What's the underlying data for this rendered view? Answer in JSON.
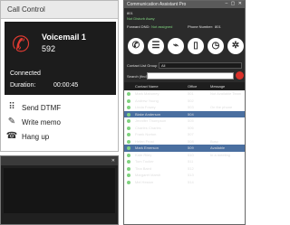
{
  "call_control": {
    "title": "Call Control",
    "contact_name": "Voicemail 1",
    "contact_number": "592",
    "status": "Connected",
    "duration_label": "Duration:",
    "duration_value": "00:00:45",
    "actions": [
      {
        "label": "Send DTMF",
        "icon": "dialpad-icon"
      },
      {
        "label": "Write memo",
        "icon": "memo-icon"
      },
      {
        "label": "Hang up",
        "icon": "hangup-icon"
      }
    ]
  },
  "phone_window": {
    "title": "",
    "buttons": [
      "",
      "",
      ""
    ]
  },
  "assistant": {
    "title": "Communication Assistant Pro",
    "header": {
      "ext": "801",
      "status": "Not Disturb Away",
      "forward_label": "Forward DND:",
      "forward_value": "Not assigned",
      "phone_label": "Phone Number:",
      "phone_value": "801"
    },
    "contact_group_label": "Contact List Group",
    "contact_group_value": "All",
    "search_label": "Search (find)",
    "columns": [
      "Contact Name",
      "Office",
      "Message"
    ],
    "contacts": [
      {
        "name": "Mark Mahoney",
        "office": "501",
        "message": "Not Available Team"
      },
      {
        "name": "Andrew Young",
        "office": "502",
        "message": ""
      },
      {
        "name": "Linda Fowey",
        "office": "503",
        "message": "On the phone"
      },
      {
        "name": "Blake Anderson",
        "office": "504",
        "message": ""
      },
      {
        "name": "Jennifer Thompson",
        "office": "505",
        "message": ""
      },
      {
        "name": "Charles Charles",
        "office": "506",
        "message": ""
      },
      {
        "name": "Frank Norton",
        "office": "507",
        "message": ""
      },
      {
        "name": "Helen Frost",
        "office": "508",
        "message": "Busy"
      },
      {
        "name": "Mark Emerson",
        "office": "509",
        "message": "Available"
      },
      {
        "name": "Kate Riley",
        "office": "510",
        "message": "In a meeting"
      },
      {
        "name": "Tom Tucker",
        "office": "511",
        "message": ""
      },
      {
        "name": "Tina Baird",
        "office": "512",
        "message": ""
      },
      {
        "name": "Margaret Marsh",
        "office": "513",
        "message": ""
      },
      {
        "name": "Mel Heston",
        "office": "514",
        "message": ""
      }
    ]
  },
  "colors": {
    "accent_red": "#d9312a",
    "dark_bg": "#2b2b2b",
    "available_green": "#7fd27f",
    "selected_row": "#4a6fa0"
  }
}
